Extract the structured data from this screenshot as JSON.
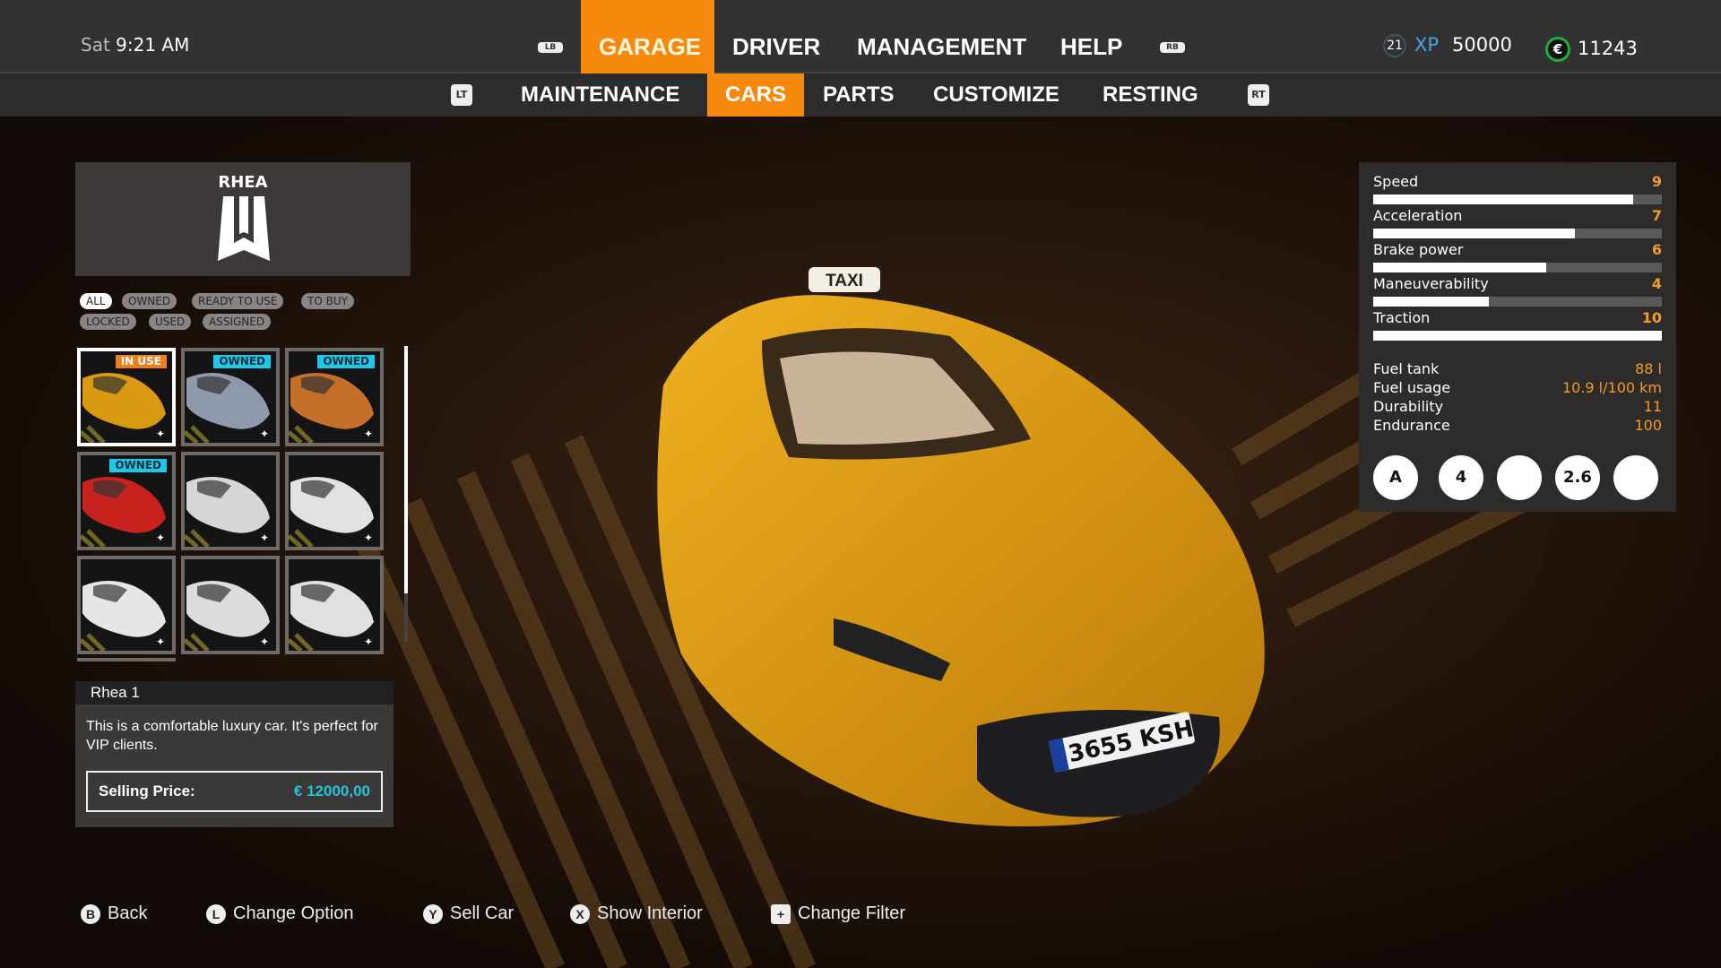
{
  "clock": {
    "day": "Sat",
    "time": "9:21 AM"
  },
  "nav": {
    "lb": "LB",
    "rb": "RB",
    "items": [
      {
        "label": "GARAGE",
        "active": true
      },
      {
        "label": "DRIVER"
      },
      {
        "label": "MANAGEMENT"
      },
      {
        "label": "HELP"
      }
    ]
  },
  "subnav": {
    "lt": "LT",
    "rt": "RT",
    "items": [
      {
        "label": "MAINTENANCE"
      },
      {
        "label": "CARS",
        "active": true
      },
      {
        "label": "PARTS"
      },
      {
        "label": "CUSTOMIZE"
      },
      {
        "label": "RESTING"
      }
    ]
  },
  "player": {
    "level": "21",
    "xp_label": "XP",
    "xp": "50000",
    "money_icon": "€",
    "money": "11243"
  },
  "brand": {
    "name": "RHEA"
  },
  "filters": [
    "ALL",
    "OWNED",
    "READY TO USE",
    "TO BUY",
    "LOCKED",
    "USED",
    "ASSIGNED"
  ],
  "cars": [
    {
      "color": "#d99a12",
      "badge": "IN USE",
      "badge_color": "#f07f1a"
    },
    {
      "color": "#8e9aab",
      "badge": "OWNED",
      "badge_color": "#1fc8e8"
    },
    {
      "color": "#c4702a",
      "badge": "OWNED",
      "badge_color": "#1fc8e8"
    },
    {
      "color": "#c8221e",
      "badge": "OWNED",
      "badge_color": "#1fc8e8"
    },
    {
      "color": "#d6d6d6"
    },
    {
      "color": "#e2e2e2"
    },
    {
      "color": "#e6e6e6"
    },
    {
      "color": "#dcdcdc"
    },
    {
      "color": "#e0e0e0"
    }
  ],
  "info": {
    "name": "Rhea  1",
    "description": "This is a comfortable luxury car. It's perfect for VIP clients.",
    "price_label": "Selling Price:",
    "price": "€ 12000,00"
  },
  "stats": {
    "bars": [
      {
        "label": "Speed",
        "value": "9",
        "fraction": 0.9
      },
      {
        "label": "Acceleration",
        "value": "7",
        "fraction": 0.7
      },
      {
        "label": "Brake power",
        "value": "6",
        "fraction": 0.6
      },
      {
        "label": "Maneuverability",
        "value": "4",
        "fraction": 0.4
      },
      {
        "label": "Traction",
        "value": "10",
        "fraction": 1.0
      }
    ],
    "specs": [
      {
        "label": "Fuel tank",
        "value": "88 l"
      },
      {
        "label": "Fuel usage",
        "value": "10.9 l/100 km"
      },
      {
        "label": "Durability",
        "value": "11"
      },
      {
        "label": "Endurance",
        "value": "100"
      }
    ],
    "features": [
      {
        "icon": "automatic-gearbox-icon",
        "text": "A"
      },
      {
        "icon": "seats-icon",
        "text": "4"
      },
      {
        "icon": "engine-type-icon",
        "text": ""
      },
      {
        "icon": "weight-icon",
        "text": "2.6"
      },
      {
        "icon": "engine-icon",
        "text": ""
      }
    ]
  },
  "car": {
    "sign": "TAXI",
    "plate": "3655 KSH"
  },
  "hints": [
    {
      "key": "B",
      "label": "Back"
    },
    {
      "key": "L",
      "label": "Change Option"
    },
    {
      "key": "Y",
      "label": "Sell Car"
    },
    {
      "key": "X",
      "label": "Show Interior"
    },
    {
      "key": "+",
      "label": "Change Filter"
    }
  ]
}
